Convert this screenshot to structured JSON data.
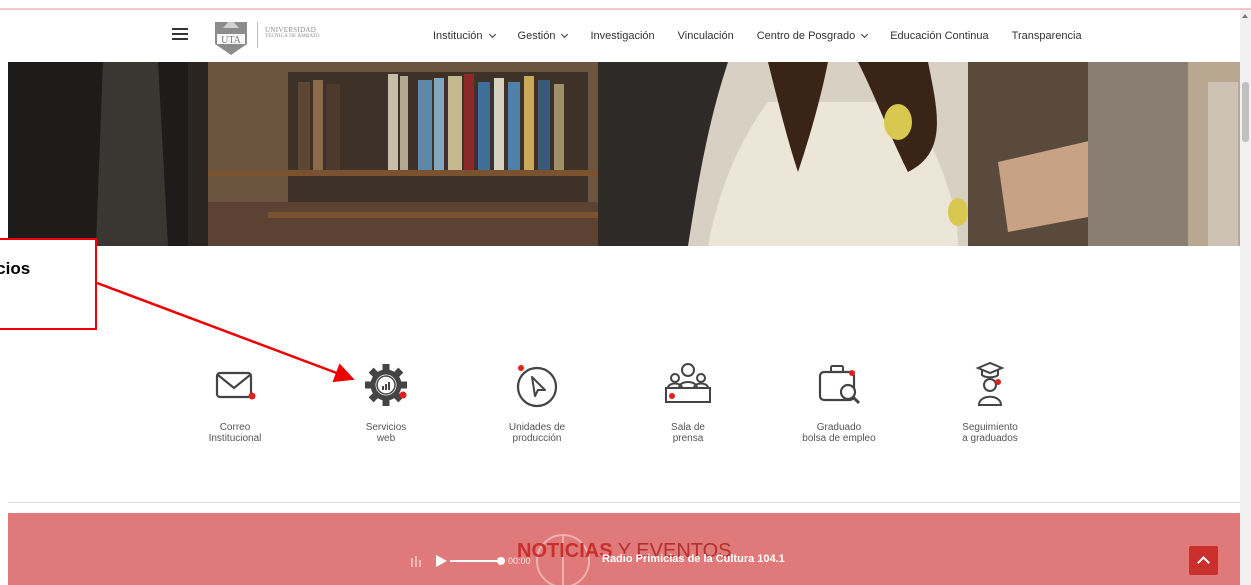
{
  "header": {
    "logo_text_line1": "UNIVERSIDAD",
    "logo_text_line2": "TÉCNICA DE AMBATO",
    "logo_abbr": "UTA",
    "nav": [
      {
        "label": "Institución",
        "has_dropdown": true
      },
      {
        "label": "Gestión",
        "has_dropdown": true
      },
      {
        "label": "Investigación",
        "has_dropdown": false
      },
      {
        "label": "Vinculación",
        "has_dropdown": false
      },
      {
        "label": "Centro de Posgrado",
        "has_dropdown": true
      },
      {
        "label": "Educación Continua",
        "has_dropdown": false
      },
      {
        "label": "Transparencia",
        "has_dropdown": false
      }
    ]
  },
  "callout": {
    "text": "vicios\nb",
    "color": "#ee0000"
  },
  "services": [
    {
      "label": "Correo\nInstitucional",
      "icon": "envelope-icon"
    },
    {
      "label": "Servicios\nweb",
      "icon": "gear-chart-icon"
    },
    {
      "label": "Unidades de\nproducción",
      "icon": "cursor-play-icon"
    },
    {
      "label": "Sala de\nprensa",
      "icon": "press-room-icon"
    },
    {
      "label": "Graduado\nbolsa de empleo",
      "icon": "briefcase-search-icon"
    },
    {
      "label": "Seguimiento\na graduados",
      "icon": "graduate-icon"
    }
  ],
  "news": {
    "title_bold": "NOTICIAS",
    "title_rest": " Y EVENTOS",
    "player_time": "00:00",
    "radio_name": "Radio Primicias de la Cultura 104.1"
  },
  "colors": {
    "accent_red": "#c9302c",
    "news_bg": "#e07a7a",
    "icon_dot": "#e0201e"
  }
}
